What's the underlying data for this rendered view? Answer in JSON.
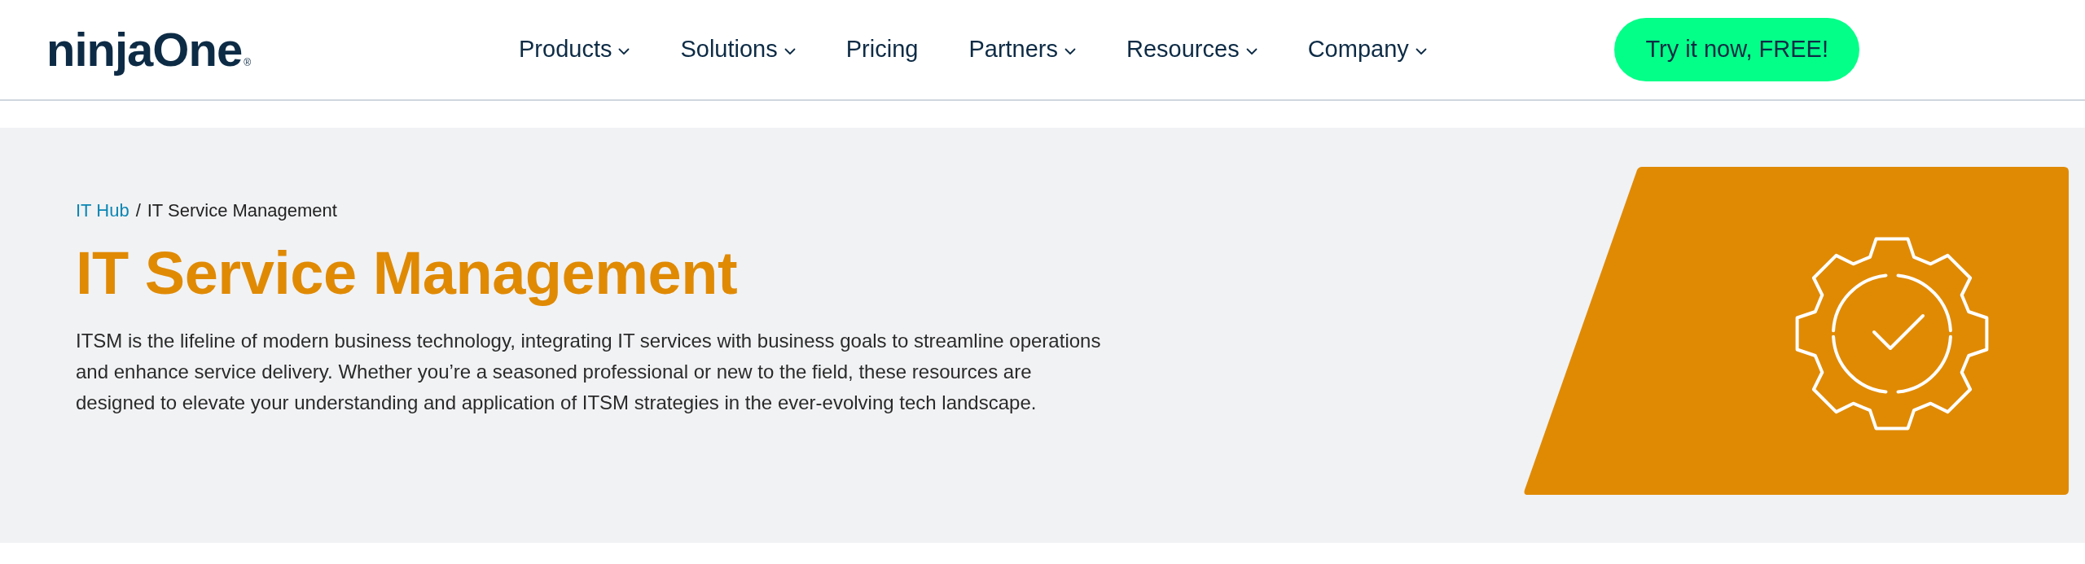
{
  "header": {
    "logo": {
      "text": "ninjaOne",
      "mark": "®"
    },
    "nav": [
      {
        "label": "Products",
        "dropdown": true
      },
      {
        "label": "Solutions",
        "dropdown": true
      },
      {
        "label": "Pricing",
        "dropdown": false
      },
      {
        "label": "Partners",
        "dropdown": true
      },
      {
        "label": "Resources",
        "dropdown": true
      },
      {
        "label": "Company",
        "dropdown": true
      }
    ],
    "cta": "Try it now, FREE!"
  },
  "hero": {
    "breadcrumb": [
      {
        "label": "IT Hub",
        "kind": "link"
      },
      {
        "label": "IT Service Management",
        "kind": "current"
      }
    ],
    "separator": "/",
    "title": "IT Service Management",
    "description": "ITSM is the lifeline of modern business technology, integrating IT services with business goals to streamline operations and enhance service delivery. Whether you’re a seasoned professional or new to the field, these resources are designed to elevate your understanding and application of ITSM strategies in the ever-evolving tech landscape."
  }
}
